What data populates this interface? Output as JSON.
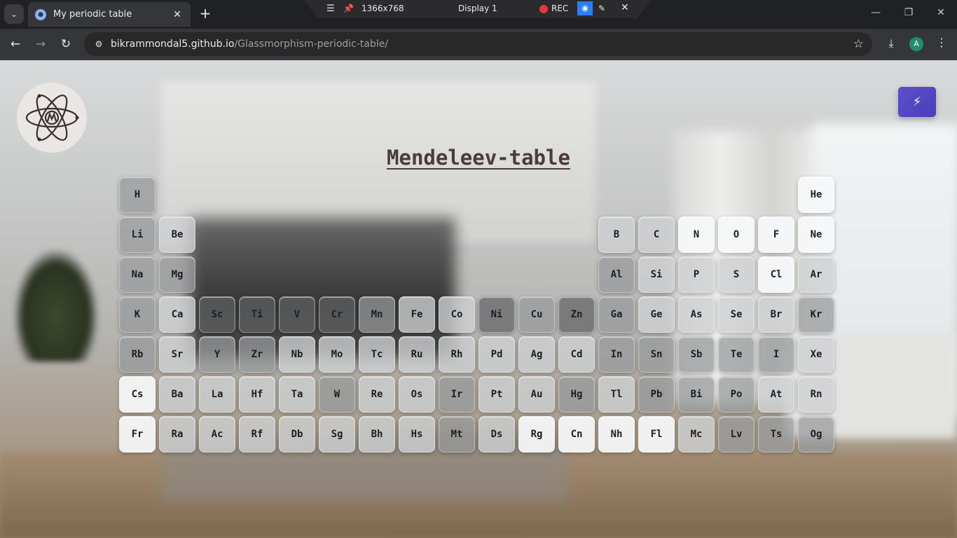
{
  "browser": {
    "tab_title": "My periodic table",
    "url_host": "bikrammondal5.github.io",
    "url_path": "/Glassmorphism-periodic-table/",
    "profile_initial": "A"
  },
  "recorder": {
    "resolution": "1366x768",
    "display": "Display 1",
    "rec_label": "REC"
  },
  "page": {
    "title": "Mendeleev-table"
  },
  "elements": [
    {
      "symbol": "H",
      "row": 1,
      "col": 1,
      "tone": "grey"
    },
    {
      "symbol": "He",
      "row": 1,
      "col": 18,
      "tone": "light"
    },
    {
      "symbol": "Li",
      "row": 2,
      "col": 1,
      "tone": "grey"
    },
    {
      "symbol": "Be",
      "row": 2,
      "col": 2,
      "tone": "mid"
    },
    {
      "symbol": "B",
      "row": 2,
      "col": 13,
      "tone": "mid"
    },
    {
      "symbol": "C",
      "row": 2,
      "col": 14,
      "tone": "mid"
    },
    {
      "symbol": "N",
      "row": 2,
      "col": 15,
      "tone": "light"
    },
    {
      "symbol": "O",
      "row": 2,
      "col": 16,
      "tone": "light"
    },
    {
      "symbol": "F",
      "row": 2,
      "col": 17,
      "tone": "light"
    },
    {
      "symbol": "Ne",
      "row": 2,
      "col": 18,
      "tone": "light"
    },
    {
      "symbol": "Na",
      "row": 3,
      "col": 1,
      "tone": "grey"
    },
    {
      "symbol": "Mg",
      "row": 3,
      "col": 2,
      "tone": "grey"
    },
    {
      "symbol": "Al",
      "row": 3,
      "col": 13,
      "tone": "grey"
    },
    {
      "symbol": "Si",
      "row": 3,
      "col": 14,
      "tone": "mid"
    },
    {
      "symbol": "P",
      "row": 3,
      "col": 15,
      "tone": "mid"
    },
    {
      "symbol": "S",
      "row": 3,
      "col": 16,
      "tone": "mid"
    },
    {
      "symbol": "Cl",
      "row": 3,
      "col": 17,
      "tone": "light"
    },
    {
      "symbol": "Ar",
      "row": 3,
      "col": 18,
      "tone": "mid"
    },
    {
      "symbol": "K",
      "row": 4,
      "col": 1,
      "tone": "grey"
    },
    {
      "symbol": "Ca",
      "row": 4,
      "col": 2,
      "tone": "mid"
    },
    {
      "symbol": "Sc",
      "row": 4,
      "col": 3,
      "tone": "dark"
    },
    {
      "symbol": "Ti",
      "row": 4,
      "col": 4,
      "tone": "dark"
    },
    {
      "symbol": "V",
      "row": 4,
      "col": 5,
      "tone": "dark"
    },
    {
      "symbol": "Cr",
      "row": 4,
      "col": 6,
      "tone": "dark"
    },
    {
      "symbol": "Mn",
      "row": 4,
      "col": 7,
      "tone": "grey"
    },
    {
      "symbol": "Fe",
      "row": 4,
      "col": 8,
      "tone": "mid"
    },
    {
      "symbol": "Co",
      "row": 4,
      "col": 9,
      "tone": "mid"
    },
    {
      "symbol": "Ni",
      "row": 4,
      "col": 10,
      "tone": "dark"
    },
    {
      "symbol": "Cu",
      "row": 4,
      "col": 11,
      "tone": "grey"
    },
    {
      "symbol": "Zn",
      "row": 4,
      "col": 12,
      "tone": "dark"
    },
    {
      "symbol": "Ga",
      "row": 4,
      "col": 13,
      "tone": "grey"
    },
    {
      "symbol": "Ge",
      "row": 4,
      "col": 14,
      "tone": "mid"
    },
    {
      "symbol": "As",
      "row": 4,
      "col": 15,
      "tone": "mid"
    },
    {
      "symbol": "Se",
      "row": 4,
      "col": 16,
      "tone": "mid"
    },
    {
      "symbol": "Br",
      "row": 4,
      "col": 17,
      "tone": "mid"
    },
    {
      "symbol": "Kr",
      "row": 4,
      "col": 18,
      "tone": "grey"
    },
    {
      "symbol": "Rb",
      "row": 5,
      "col": 1,
      "tone": "grey"
    },
    {
      "symbol": "Sr",
      "row": 5,
      "col": 2,
      "tone": "mid"
    },
    {
      "symbol": "Y",
      "row": 5,
      "col": 3,
      "tone": "grey"
    },
    {
      "symbol": "Zr",
      "row": 5,
      "col": 4,
      "tone": "grey"
    },
    {
      "symbol": "Nb",
      "row": 5,
      "col": 5,
      "tone": "mid"
    },
    {
      "symbol": "Mo",
      "row": 5,
      "col": 6,
      "tone": "mid"
    },
    {
      "symbol": "Tc",
      "row": 5,
      "col": 7,
      "tone": "mid"
    },
    {
      "symbol": "Ru",
      "row": 5,
      "col": 8,
      "tone": "mid"
    },
    {
      "symbol": "Rh",
      "row": 5,
      "col": 9,
      "tone": "mid"
    },
    {
      "symbol": "Pd",
      "row": 5,
      "col": 10,
      "tone": "mid"
    },
    {
      "symbol": "Ag",
      "row": 5,
      "col": 11,
      "tone": "mid"
    },
    {
      "symbol": "Cd",
      "row": 5,
      "col": 12,
      "tone": "mid"
    },
    {
      "symbol": "In",
      "row": 5,
      "col": 13,
      "tone": "grey"
    },
    {
      "symbol": "Sn",
      "row": 5,
      "col": 14,
      "tone": "grey"
    },
    {
      "symbol": "Sb",
      "row": 5,
      "col": 15,
      "tone": "grey"
    },
    {
      "symbol": "Te",
      "row": 5,
      "col": 16,
      "tone": "grey"
    },
    {
      "symbol": "I",
      "row": 5,
      "col": 17,
      "tone": "grey"
    },
    {
      "symbol": "Xe",
      "row": 5,
      "col": 18,
      "tone": "mid"
    },
    {
      "symbol": "Cs",
      "row": 6,
      "col": 1,
      "tone": "light"
    },
    {
      "symbol": "Ba",
      "row": 6,
      "col": 2,
      "tone": "mid"
    },
    {
      "symbol": "La",
      "row": 6,
      "col": 3,
      "tone": "mid"
    },
    {
      "symbol": "Hf",
      "row": 6,
      "col": 4,
      "tone": "mid"
    },
    {
      "symbol": "Ta",
      "row": 6,
      "col": 5,
      "tone": "mid"
    },
    {
      "symbol": "W",
      "row": 6,
      "col": 6,
      "tone": "grey"
    },
    {
      "symbol": "Re",
      "row": 6,
      "col": 7,
      "tone": "mid"
    },
    {
      "symbol": "Os",
      "row": 6,
      "col": 8,
      "tone": "mid"
    },
    {
      "symbol": "Ir",
      "row": 6,
      "col": 9,
      "tone": "grey"
    },
    {
      "symbol": "Pt",
      "row": 6,
      "col": 10,
      "tone": "mid"
    },
    {
      "symbol": "Au",
      "row": 6,
      "col": 11,
      "tone": "mid"
    },
    {
      "symbol": "Hg",
      "row": 6,
      "col": 12,
      "tone": "grey"
    },
    {
      "symbol": "Tl",
      "row": 6,
      "col": 13,
      "tone": "mid"
    },
    {
      "symbol": "Pb",
      "row": 6,
      "col": 14,
      "tone": "grey"
    },
    {
      "symbol": "Bi",
      "row": 6,
      "col": 15,
      "tone": "grey"
    },
    {
      "symbol": "Po",
      "row": 6,
      "col": 16,
      "tone": "grey"
    },
    {
      "symbol": "At",
      "row": 6,
      "col": 17,
      "tone": "mid"
    },
    {
      "symbol": "Rn",
      "row": 6,
      "col": 18,
      "tone": "mid"
    },
    {
      "symbol": "Fr",
      "row": 7,
      "col": 1,
      "tone": "light"
    },
    {
      "symbol": "Ra",
      "row": 7,
      "col": 2,
      "tone": "mid"
    },
    {
      "symbol": "Ac",
      "row": 7,
      "col": 3,
      "tone": "mid"
    },
    {
      "symbol": "Rf",
      "row": 7,
      "col": 4,
      "tone": "mid"
    },
    {
      "symbol": "Db",
      "row": 7,
      "col": 5,
      "tone": "mid"
    },
    {
      "symbol": "Sg",
      "row": 7,
      "col": 6,
      "tone": "mid"
    },
    {
      "symbol": "Bh",
      "row": 7,
      "col": 7,
      "tone": "mid"
    },
    {
      "symbol": "Hs",
      "row": 7,
      "col": 8,
      "tone": "mid"
    },
    {
      "symbol": "Mt",
      "row": 7,
      "col": 9,
      "tone": "grey"
    },
    {
      "symbol": "Ds",
      "row": 7,
      "col": 10,
      "tone": "mid"
    },
    {
      "symbol": "Rg",
      "row": 7,
      "col": 11,
      "tone": "light"
    },
    {
      "symbol": "Cn",
      "row": 7,
      "col": 12,
      "tone": "light"
    },
    {
      "symbol": "Nh",
      "row": 7,
      "col": 13,
      "tone": "light"
    },
    {
      "symbol": "Fl",
      "row": 7,
      "col": 14,
      "tone": "light"
    },
    {
      "symbol": "Mc",
      "row": 7,
      "col": 15,
      "tone": "mid"
    },
    {
      "symbol": "Lv",
      "row": 7,
      "col": 16,
      "tone": "grey"
    },
    {
      "symbol": "Ts",
      "row": 7,
      "col": 17,
      "tone": "grey"
    },
    {
      "symbol": "Og",
      "row": 7,
      "col": 18,
      "tone": "grey"
    }
  ],
  "colors": {
    "accent_button": "#5346c7",
    "title": "#4d3a3d"
  },
  "icons": {
    "logo": "atom-logo-icon",
    "action_button": "lightning-bolt-icon"
  }
}
